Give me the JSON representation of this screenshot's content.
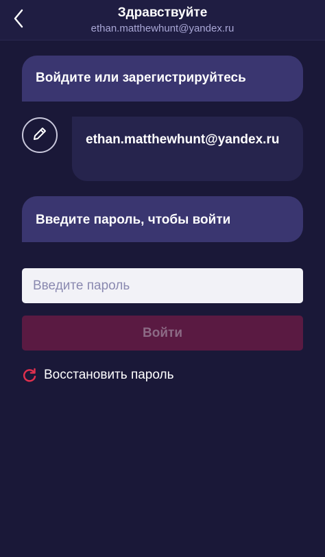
{
  "header": {
    "back_icon": "chevron-left-icon",
    "title": "Здравствуйте",
    "subtitle": "ethan.matthewhunt@yandex.ru"
  },
  "chat": {
    "bot_message_1": "Войдите или зарегистрируйтесь",
    "edit_icon": "pencil-icon",
    "user_email": "ethan.matthewhunt@yandex.ru",
    "bot_message_2": "Введите пароль, чтобы войти"
  },
  "form": {
    "password_placeholder": "Введите пароль",
    "password_value": "",
    "login_label": "Войти",
    "restore_icon": "refresh-icon",
    "restore_label": "Восстановить пароль"
  },
  "colors": {
    "background": "#1a1838",
    "header_bg": "#1f1d42",
    "bot_bubble": "#3a3670",
    "user_bubble": "#26244d",
    "login_button": "#5a1a42",
    "accent_red": "#e0304e",
    "subtitle": "#a9a7d6"
  }
}
